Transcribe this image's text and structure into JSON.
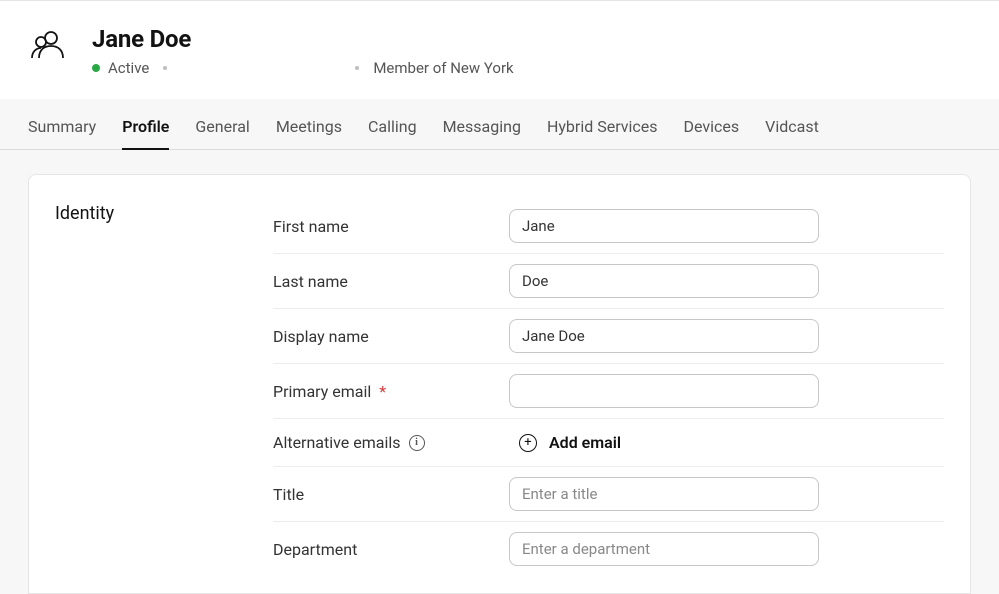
{
  "header": {
    "title": "Jane Doe",
    "status_label": "Active",
    "status_color": "#2aa846",
    "member_label": "Member of New York"
  },
  "tabs": [
    {
      "label": "Summary",
      "active": false
    },
    {
      "label": "Profile",
      "active": true
    },
    {
      "label": "General",
      "active": false
    },
    {
      "label": "Meetings",
      "active": false
    },
    {
      "label": "Calling",
      "active": false
    },
    {
      "label": "Messaging",
      "active": false
    },
    {
      "label": "Hybrid Services",
      "active": false
    },
    {
      "label": "Devices",
      "active": false
    },
    {
      "label": "Vidcast",
      "active": false
    }
  ],
  "section": {
    "title": "Identity",
    "fields": {
      "first_name": {
        "label": "First name",
        "value": "Jane",
        "placeholder": ""
      },
      "last_name": {
        "label": "Last name",
        "value": "Doe",
        "placeholder": ""
      },
      "display_name": {
        "label": "Display name",
        "value": "Jane Doe",
        "placeholder": ""
      },
      "primary_email": {
        "label": "Primary email",
        "required": true,
        "value": "",
        "placeholder": ""
      },
      "alt_emails": {
        "label": "Alternative emails",
        "add_label": "Add email"
      },
      "title": {
        "label": "Title",
        "value": "",
        "placeholder": "Enter a title"
      },
      "department": {
        "label": "Department",
        "value": "",
        "placeholder": "Enter a department"
      }
    }
  }
}
